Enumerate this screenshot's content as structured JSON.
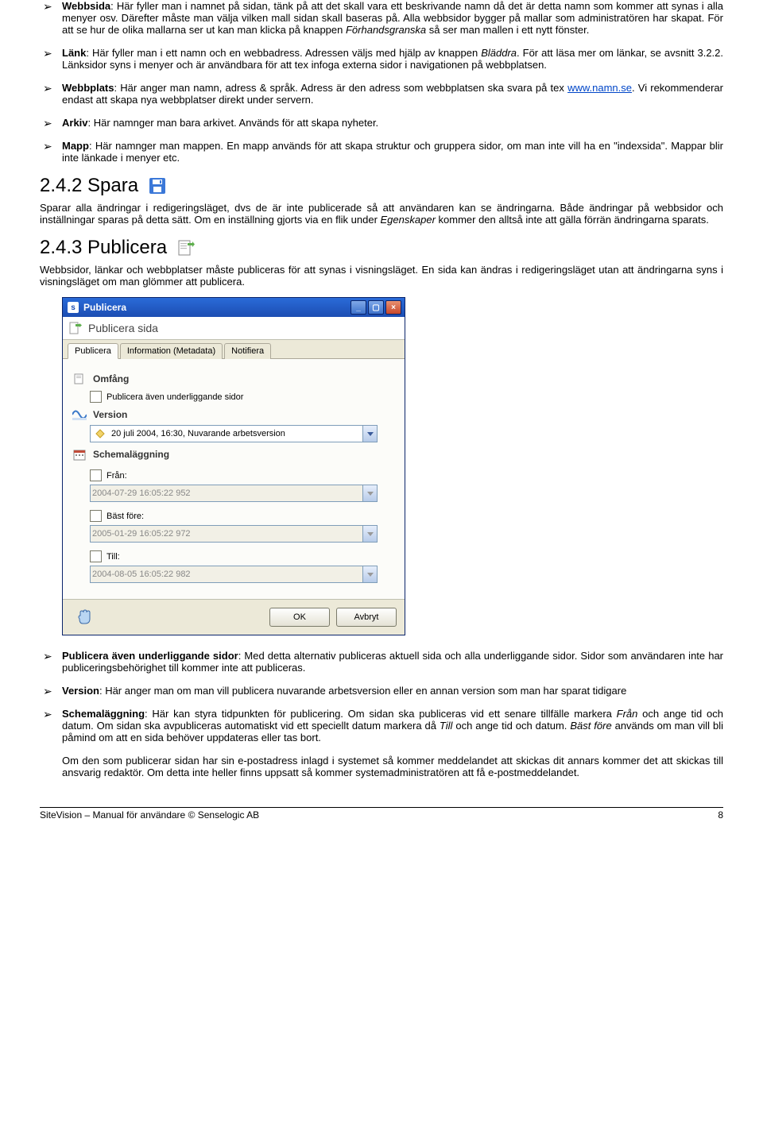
{
  "bullets_top": [
    {
      "bold": "Webbsida",
      "text": ": Här fyller man i namnet på sidan, tänk på att det skall vara ett beskrivande namn då det är detta namn som kommer att synas i alla menyer osv. Därefter måste man välja vilken mall sidan skall baseras på. Alla webbsidor bygger på mallar som administratören har skapat. För att se hur de olika mallarna ser ut kan man klicka på knappen ",
      "italic": "Förhandsgranska",
      "tail": " så ser man mallen i ett nytt fönster."
    },
    {
      "bold": "Länk",
      "text": ": Här fyller man i ett namn och en webbadress. Adressen väljs med hjälp av knappen ",
      "italic": "Bläddra",
      "tail": ". För att läsa mer om länkar, se avsnitt 3.2.2. Länksidor syns i menyer och är användbara för att tex infoga externa sidor i navigationen på webbplatsen."
    },
    {
      "bold": "Webbplats",
      "text": ": Här anger man namn, adress & språk. Adress är den adress som webbplatsen ska svara på tex ",
      "link": "www.namn.se",
      "tail": ".  Vi rekommenderar endast att skapa nya webbplatser direkt under servern."
    },
    {
      "bold": "Arkiv",
      "text": ": Här namnger man bara arkivet. Används för att skapa nyheter."
    },
    {
      "bold": "Mapp",
      "text": ": Här namnger man mappen. En mapp används för att skapa struktur och gruppera sidor, om man inte vill ha en \"indexsida\". Mappar blir inte länkade i menyer etc."
    }
  ],
  "spara": {
    "heading": "2.4.2 Spara",
    "para": "Sparar alla ändringar i redigeringsläget, dvs de är inte publicerade så att användaren kan se ändringarna.  Både ändringar på webbsidor och inställningar sparas på detta sätt. Om en inställning gjorts via en flik under ",
    "italic": "Egenskaper",
    "tail": " kommer den alltså inte att gälla förrän ändringarna sparats."
  },
  "publicera": {
    "heading": "2.4.3 Publicera",
    "para": "Webbsidor, länkar och webbplatser måste publiceras för att synas i visningsläget. En sida kan ändras i redigeringsläget utan att ändringarna syns i visningsläget om man glömmer att publicera."
  },
  "dialog": {
    "title": "Publicera",
    "subtitle": "Publicera sida",
    "tabs": [
      "Publicera",
      "Information (Metadata)",
      "Notifiera"
    ],
    "sections": {
      "omfang": {
        "label": "Omfång",
        "check": "Publicera även underliggande sidor"
      },
      "version": {
        "label": "Version",
        "value": "20 juli 2004, 16:30, Nuvarande arbetsversion"
      },
      "schemalaggning": {
        "label": "Schemaläggning",
        "fields": [
          {
            "label": "Från:",
            "value": "2004-07-29 16:05:22 952"
          },
          {
            "label": "Bäst före:",
            "value": "2005-01-29 16:05:22 972"
          },
          {
            "label": "Till:",
            "value": "2004-08-05 16:05:22 982"
          }
        ]
      }
    },
    "buttons": {
      "ok": "OK",
      "cancel": "Avbryt"
    }
  },
  "bullets_bottom": [
    {
      "bold": "Publicera även underliggande sidor",
      "text": ": Med detta alternativ publiceras aktuell sida och alla underliggande sidor. Sidor som användaren inte har publiceringsbehörighet till kommer inte att publiceras."
    },
    {
      "bold": "Version",
      "text": ": Här anger man om man vill publicera nuvarande arbetsversion eller en annan version som man har sparat tidigare"
    },
    {
      "bold": "Schemaläggning",
      "text": ": Här kan styra tidpunkten för publicering. Om sidan ska publiceras vid ett senare tillfälle markera ",
      "italic": "Från",
      "mid": " och ange tid och datum. Om sidan ska avpubliceras automatiskt vid ett speciellt datum markera då ",
      "italic2": "Till",
      "mid2": " och ange tid och datum. ",
      "italic3": "Bäst före",
      "tail": " används om man vill bli påmind om att en sida behöver uppdateras eller tas bort."
    }
  ],
  "epost_para": "Om den som publicerar sidan har sin e-postadress  inlagd i systemet så kommer meddelandet att skickas dit annars kommer det att skickas till ansvarig redaktör. Om detta inte heller finns uppsatt så kommer systemadministratören att få e-postmeddelandet.",
  "footer": {
    "left": "SiteVision – Manual för användare © Senselogic AB",
    "right": "8"
  }
}
